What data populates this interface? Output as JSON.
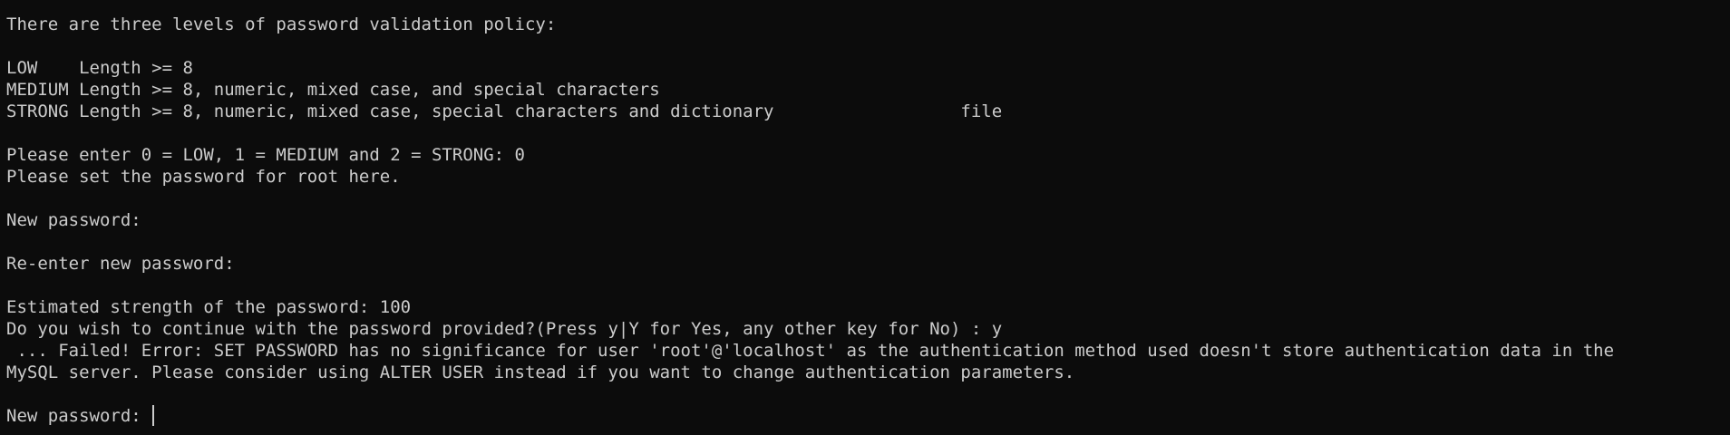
{
  "terminal": {
    "lines": [
      "There are three levels of password validation policy:",
      "",
      "LOW    Length >= 8",
      "MEDIUM Length >= 8, numeric, mixed case, and special characters",
      "STRONG Length >= 8, numeric, mixed case, special characters and dictionary                  file",
      "",
      "Please enter 0 = LOW, 1 = MEDIUM and 2 = STRONG: 0",
      "Please set the password for root here.",
      "",
      "New password:",
      "",
      "Re-enter new password:",
      "",
      "Estimated strength of the password: 100",
      "Do you wish to continue with the password provided?(Press y|Y for Yes, any other key for No) : y",
      " ... Failed! Error: SET PASSWORD has no significance for user 'root'@'localhost' as the authentication method used doesn't store authentication data in the",
      "MySQL server. Please consider using ALTER USER instead if you want to change authentication parameters.",
      ""
    ],
    "active_prompt": "New password: "
  }
}
